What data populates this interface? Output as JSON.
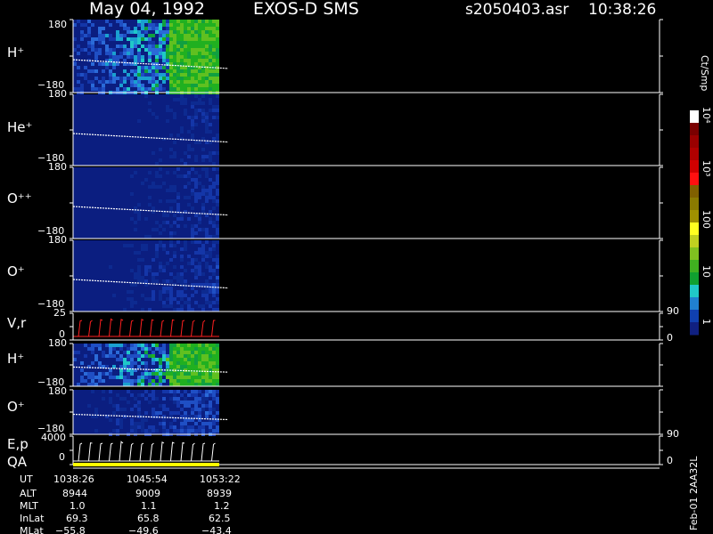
{
  "header": {
    "date": "May 04, 1992",
    "instrument": "EXOS-D SMS",
    "filename": "s2050403.asr",
    "time": "10:38:26"
  },
  "colorbar": {
    "unit": "Ct/Smp",
    "labels": [
      "10⁴",
      "10³",
      "100",
      "10",
      "1"
    ]
  },
  "footer_label": "Feb-01 2AA32L",
  "chart_data": [
    {
      "type": "heatmap",
      "panel": "H+",
      "label": "H⁺",
      "ylim": [
        -180,
        180
      ],
      "tick_top": "180",
      "tick_bottom": "−180",
      "seed": 11,
      "bright": 0.85,
      "green": true
    },
    {
      "type": "heatmap",
      "panel": "He+",
      "label": "He⁺",
      "ylim": [
        -180,
        180
      ],
      "tick_top": "180",
      "tick_bottom": "−180",
      "seed": 23,
      "bright": 0.3,
      "green": false
    },
    {
      "type": "heatmap",
      "panel": "O++",
      "label": "O⁺⁺",
      "ylim": [
        -180,
        180
      ],
      "tick_top": "180",
      "tick_bottom": "−180",
      "seed": 37,
      "bright": 0.35,
      "green": false
    },
    {
      "type": "heatmap",
      "panel": "O+",
      "label": "O⁺",
      "ylim": [
        -180,
        180
      ],
      "tick_top": "180",
      "tick_bottom": "−180",
      "seed": 41,
      "bright": 0.4,
      "green": false
    },
    {
      "type": "line",
      "panel": "V,r",
      "label": "V,r",
      "ylim_left": [
        0,
        25
      ],
      "tick_left_top": "25",
      "tick_left_bottom": "0",
      "tick_right_top": "90",
      "tick_right_bottom": "0",
      "color": "#ff2020"
    },
    {
      "type": "heatmap",
      "panel": "H+ (2)",
      "label": "H⁺",
      "ylim": [
        -180,
        180
      ],
      "tick_top": "180",
      "tick_bottom": "−180",
      "seed": 53,
      "bright": 0.9,
      "green": true
    },
    {
      "type": "heatmap",
      "panel": "O+ (2)",
      "label": "O⁺",
      "ylim": [
        -180,
        180
      ],
      "tick_top": "180",
      "tick_bottom": "−180",
      "seed": 67,
      "bright": 0.55,
      "green": false
    },
    {
      "type": "line",
      "panel": "E,p QA",
      "label": "E,p",
      "label2": "QA",
      "ylim_left": [
        0,
        4000
      ],
      "tick_left_top": "4000",
      "tick_left_bottom": "0",
      "tick_right_top": "90",
      "tick_right_bottom": "0",
      "color": "#ffffff"
    }
  ],
  "orbit_table": {
    "rows": [
      {
        "name": "UT",
        "values": [
          "1038:26",
          "1045:54",
          "1053:22"
        ]
      },
      {
        "name": "ALT",
        "values": [
          "8944",
          "9009",
          "8939"
        ]
      },
      {
        "name": "MLT",
        "values": [
          "1.0",
          "1.1",
          "1.2"
        ]
      },
      {
        "name": "InLat",
        "values": [
          "69.3",
          "65.8",
          "62.5"
        ]
      },
      {
        "name": "MLat",
        "values": [
          "−55.8",
          "−49.6",
          "−43.4"
        ]
      }
    ]
  }
}
